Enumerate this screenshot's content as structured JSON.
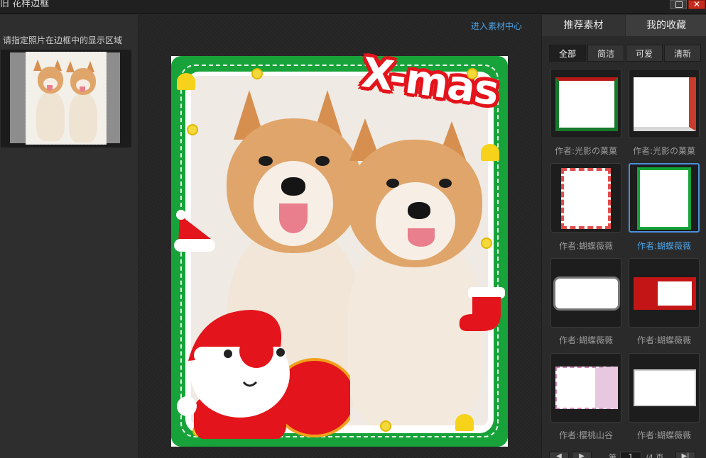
{
  "window": {
    "title": "旧 花样边框"
  },
  "left": {
    "hint": "请指定照片在边框中的显示区域"
  },
  "center": {
    "link": "进入素材中心",
    "frame_text": "X-mas"
  },
  "right": {
    "tabs": [
      {
        "label": "推荐素材"
      },
      {
        "label": "我的收藏"
      }
    ],
    "filters": [
      {
        "label": "全部"
      },
      {
        "label": "简洁"
      },
      {
        "label": "可爱"
      },
      {
        "label": "清新"
      }
    ],
    "thumbs": [
      {
        "author": "作者:光影の菓菓",
        "theme": "christmas-green"
      },
      {
        "author": "作者:光影の菓菓",
        "theme": "winter-stripes"
      },
      {
        "author": "作者:蝴蝶薇薇",
        "theme": "candy-stripe"
      },
      {
        "author": "作者:蝴蝶薇薇",
        "theme": "xmas-santa"
      },
      {
        "author": "作者:蝴蝶薇薇",
        "theme": "rough-white"
      },
      {
        "author": "作者:蝴蝶薇薇",
        "theme": "red-xmas"
      },
      {
        "author": "作者:樱桃山谷",
        "theme": "pink-cute"
      },
      {
        "author": "作者:蝴蝶薇薇",
        "theme": "white-simple"
      }
    ],
    "pager": {
      "prefix": "第",
      "page": "1",
      "suffix": "/4 页"
    }
  },
  "colors": {
    "accent": "#4a90d9",
    "frame_green": "#17a33a",
    "xmas_red": "#e3141b"
  }
}
